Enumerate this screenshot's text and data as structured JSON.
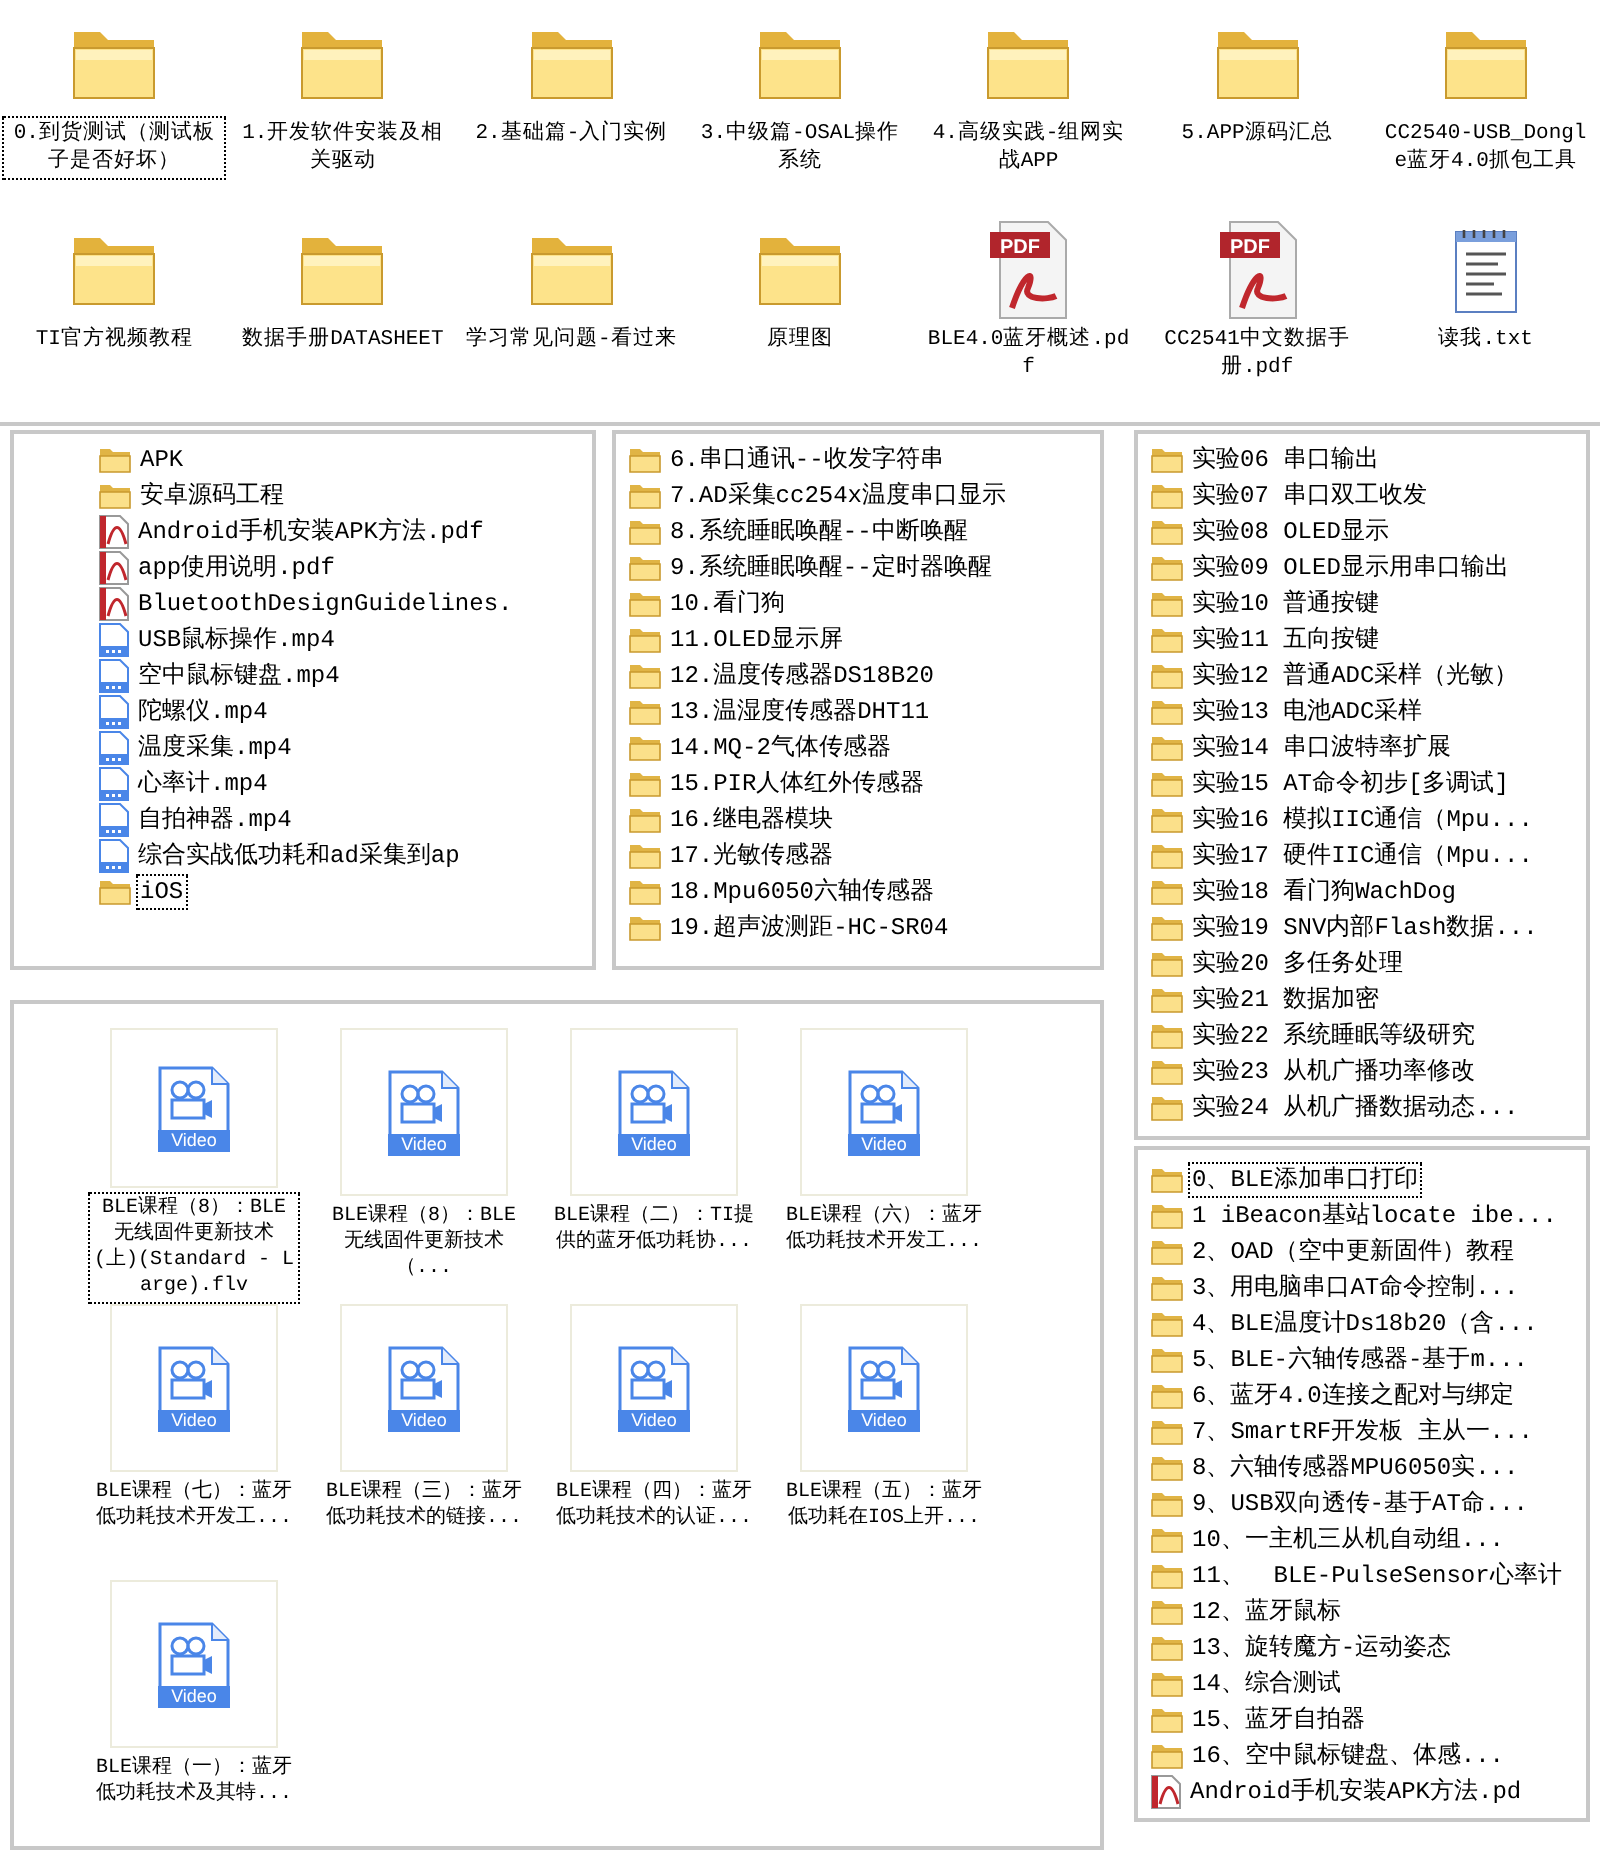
{
  "top_grid": [
    {
      "label": "0.到货测试（测试板子是否好坏）",
      "kind": "folder",
      "selected": true
    },
    {
      "label": "1.开发软件安装及相关驱动",
      "kind": "folder",
      "selected": false
    },
    {
      "label": "2.基础篇-入门实例",
      "kind": "folder",
      "selected": false
    },
    {
      "label": "3.中级篇-OSAL操作系统",
      "kind": "folder",
      "selected": false
    },
    {
      "label": "4.高级实践-组网实战APP",
      "kind": "folder",
      "selected": false
    },
    {
      "label": "5.APP源码汇总",
      "kind": "folder",
      "selected": false
    },
    {
      "label": "CC2540-USB_Dongle蓝牙4.0抓包工具",
      "kind": "folder",
      "selected": false
    },
    {
      "label": "TI官方视频教程",
      "kind": "folder",
      "selected": false
    },
    {
      "label": "数据手册DATASHEET",
      "kind": "folder",
      "selected": false
    },
    {
      "label": "学习常见问题-看过来",
      "kind": "folder",
      "selected": false
    },
    {
      "label": "原理图",
      "kind": "folder",
      "selected": false
    },
    {
      "label": "BLE4.0蓝牙概述.pdf",
      "kind": "pdf",
      "icon_label": "PDF",
      "selected": false
    },
    {
      "label": "CC2541中文数据手册.pdf",
      "kind": "pdf",
      "icon_label": "PDF",
      "selected": false
    },
    {
      "label": "读我.txt",
      "kind": "txt",
      "selected": false
    }
  ],
  "left_list": [
    {
      "label": "APK",
      "kind": "folder",
      "selected": false
    },
    {
      "label": "安卓源码工程",
      "kind": "folder",
      "selected": false
    },
    {
      "label": "Android手机安装APK方法.pdf",
      "kind": "pdf",
      "selected": false
    },
    {
      "label": "app使用说明.pdf",
      "kind": "pdf",
      "selected": false
    },
    {
      "label": "BluetoothDesignGuidelines.",
      "kind": "pdf",
      "selected": false
    },
    {
      "label": "USB鼠标操作.mp4",
      "kind": "video",
      "selected": false
    },
    {
      "label": "空中鼠标键盘.mp4",
      "kind": "video",
      "selected": false
    },
    {
      "label": "陀螺仪.mp4",
      "kind": "video",
      "selected": false
    },
    {
      "label": "温度采集.mp4",
      "kind": "video",
      "selected": false
    },
    {
      "label": "心率计.mp4",
      "kind": "video",
      "selected": false
    },
    {
      "label": "自拍神器.mp4",
      "kind": "video",
      "selected": false
    },
    {
      "label": "综合实战低功耗和ad采集到ap",
      "kind": "video",
      "selected": false
    },
    {
      "label": "iOS",
      "kind": "folder",
      "selected": true
    }
  ],
  "middle_list": [
    {
      "label": "6.串口通讯--收发字符串",
      "kind": "folder",
      "selected": false
    },
    {
      "label": "7.AD采集cc254x温度串口显示",
      "kind": "folder",
      "selected": false
    },
    {
      "label": "8.系统睡眠唤醒--中断唤醒",
      "kind": "folder",
      "selected": false
    },
    {
      "label": "9.系统睡眠唤醒--定时器唤醒",
      "kind": "folder",
      "selected": false
    },
    {
      "label": "10.看门狗",
      "kind": "folder",
      "selected": false
    },
    {
      "label": "11.OLED显示屏",
      "kind": "folder",
      "selected": false
    },
    {
      "label": "12.温度传感器DS18B20",
      "kind": "folder",
      "selected": false
    },
    {
      "label": "13.温湿度传感器DHT11",
      "kind": "folder",
      "selected": false
    },
    {
      "label": "14.MQ-2气体传感器",
      "kind": "folder",
      "selected": false
    },
    {
      "label": "15.PIR人体红外传感器",
      "kind": "folder",
      "selected": false
    },
    {
      "label": "16.继电器模块",
      "kind": "folder",
      "selected": false
    },
    {
      "label": "17.光敏传感器",
      "kind": "folder",
      "selected": false
    },
    {
      "label": "18.Mpu6050六轴传感器",
      "kind": "folder",
      "selected": false
    },
    {
      "label": "19.超声波测距-HC-SR04",
      "kind": "folder",
      "selected": false
    }
  ],
  "video_grid": [
    {
      "label": "BLE课程（8）：BLE无线固件更新技术(上)(Standard - Large).flv",
      "icon_label": "Video",
      "selected": true
    },
    {
      "label": "BLE课程（8）：BLE无线固件更新技术（...",
      "icon_label": "Video",
      "selected": false
    },
    {
      "label": "BLE课程（二）：TI提供的蓝牙低功耗协...",
      "icon_label": "Video",
      "selected": false
    },
    {
      "label": "BLE课程（六）：蓝牙低功耗技术开发工...",
      "icon_label": "Video",
      "selected": false
    },
    {
      "label": "BLE课程（七）：蓝牙低功耗技术开发工...",
      "icon_label": "Video",
      "selected": false
    },
    {
      "label": "BLE课程（三）：蓝牙低功耗技术的链接...",
      "icon_label": "Video",
      "selected": false
    },
    {
      "label": "BLE课程（四）：蓝牙低功耗技术的认证...",
      "icon_label": "Video",
      "selected": false
    },
    {
      "label": "BLE课程（五）：蓝牙低功耗在IOS上开...",
      "icon_label": "Video",
      "selected": false
    },
    {
      "label": "BLE课程（一）：蓝牙低功耗技术及其特...",
      "icon_label": "Video",
      "selected": false
    }
  ],
  "right_list_1": [
    {
      "label": "实验06 串口输出",
      "kind": "folder",
      "selected": false
    },
    {
      "label": "实验07 串口双工收发",
      "kind": "folder",
      "selected": false
    },
    {
      "label": "实验08 OLED显示",
      "kind": "folder",
      "selected": false
    },
    {
      "label": "实验09 OLED显示用串口输出",
      "kind": "folder",
      "selected": false
    },
    {
      "label": "实验10 普通按键",
      "kind": "folder",
      "selected": false
    },
    {
      "label": "实验11 五向按键",
      "kind": "folder",
      "selected": false
    },
    {
      "label": "实验12 普通ADC采样（光敏）",
      "kind": "folder",
      "selected": false
    },
    {
      "label": "实验13 电池ADC采样",
      "kind": "folder",
      "selected": false
    },
    {
      "label": "实验14 串口波特率扩展",
      "kind": "folder",
      "selected": false
    },
    {
      "label": "实验15 AT命令初步[多调试]",
      "kind": "folder",
      "selected": false
    },
    {
      "label": "实验16 模拟IIC通信（Mpu...",
      "kind": "folder",
      "selected": false
    },
    {
      "label": "实验17 硬件IIC通信（Mpu...",
      "kind": "folder",
      "selected": false
    },
    {
      "label": "实验18 看门狗WachDog",
      "kind": "folder",
      "selected": false
    },
    {
      "label": "实验19 SNV内部Flash数据...",
      "kind": "folder",
      "selected": false
    },
    {
      "label": "实验20 多任务处理",
      "kind": "folder",
      "selected": false
    },
    {
      "label": "实验21 数据加密",
      "kind": "folder",
      "selected": false
    },
    {
      "label": "实验22 系统睡眠等级研究",
      "kind": "folder",
      "selected": false
    },
    {
      "label": "实验23 从机广播功率修改",
      "kind": "folder",
      "selected": false
    },
    {
      "label": "实验24 从机广播数据动态...",
      "kind": "folder",
      "selected": false
    }
  ],
  "right_list_2": [
    {
      "label": "0、BLE添加串口打印",
      "kind": "folder",
      "selected": true
    },
    {
      "label": "1 iBeacon基站locate ibe...",
      "kind": "folder",
      "selected": false
    },
    {
      "label": "2、OAD（空中更新固件）教程",
      "kind": "folder",
      "selected": false
    },
    {
      "label": "3、用电脑串口AT命令控制...",
      "kind": "folder",
      "selected": false
    },
    {
      "label": "4、BLE温度计Ds18b20（含...",
      "kind": "folder",
      "selected": false
    },
    {
      "label": "5、BLE-六轴传感器-基于m...",
      "kind": "folder",
      "selected": false
    },
    {
      "label": "6、蓝牙4.0连接之配对与绑定",
      "kind": "folder",
      "selected": false
    },
    {
      "label": "7、SmartRF开发板 主从一...",
      "kind": "folder",
      "selected": false
    },
    {
      "label": "8、六轴传感器MPU6050实...",
      "kind": "folder",
      "selected": false
    },
    {
      "label": "9、USB双向透传-基于AT命...",
      "kind": "folder",
      "selected": false
    },
    {
      "label": "10、一主机三从机自动组...",
      "kind": "folder",
      "selected": false
    },
    {
      "label": "11、  BLE-PulseSensor心率计",
      "kind": "folder",
      "selected": false
    },
    {
      "label": "12、蓝牙鼠标",
      "kind": "folder",
      "selected": false
    },
    {
      "label": "13、旋转魔方-运动姿态",
      "kind": "folder",
      "selected": false
    },
    {
      "label": "14、综合测试",
      "kind": "folder",
      "selected": false
    },
    {
      "label": "15、蓝牙自拍器",
      "kind": "folder",
      "selected": false
    },
    {
      "label": "16、空中鼠标键盘、体感...",
      "kind": "folder",
      "selected": false
    },
    {
      "label": "Android手机安装APK方法.pd",
      "kind": "pdf",
      "selected": false
    }
  ]
}
